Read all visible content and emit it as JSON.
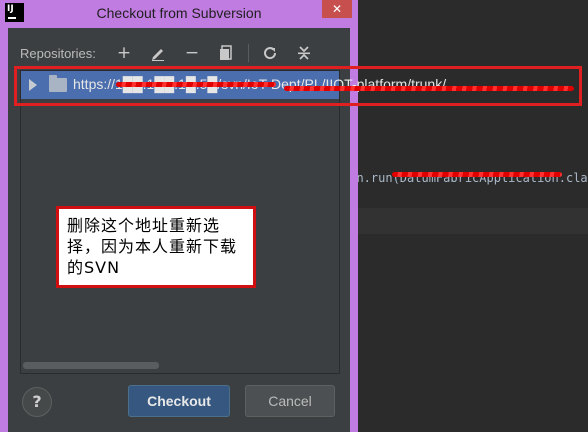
{
  "window": {
    "title": "Checkout from Subversion",
    "app_icon_text": "IJ",
    "close_symbol": "✕"
  },
  "toolbar": {
    "label": "Repositories:",
    "buttons": [
      {
        "name": "add",
        "icon": "plus-icon",
        "glyph": "+"
      },
      {
        "name": "edit",
        "icon": "pencil-icon"
      },
      {
        "name": "remove",
        "icon": "minus-icon",
        "glyph": "−"
      },
      {
        "name": "browse",
        "icon": "document-icon"
      },
      {
        "name": "refresh",
        "icon": "refresh-icon"
      },
      {
        "name": "collapse",
        "icon": "collapse-icon"
      }
    ]
  },
  "repositories": [
    {
      "url": "https://1██.1██.1█.5█/svn/IoT-Dept/PL/IIOT-platform/trunk/...",
      "expanded": false,
      "selected": true
    }
  ],
  "background_editor": {
    "code_line": "ion.run(DatumFabricApplication.cla"
  },
  "annotation": {
    "text": "删除这个地址重新选择，因为本人重新下载的SVN"
  },
  "buttons": {
    "help": "?",
    "checkout": "Checkout",
    "cancel": "Cancel"
  },
  "colors": {
    "title_bar": "#c07ce0",
    "selection": "#4b6eaf",
    "annotation_red": "#e02020",
    "dialog_bg": "#3c3f41",
    "checkout_button": "#365880"
  }
}
